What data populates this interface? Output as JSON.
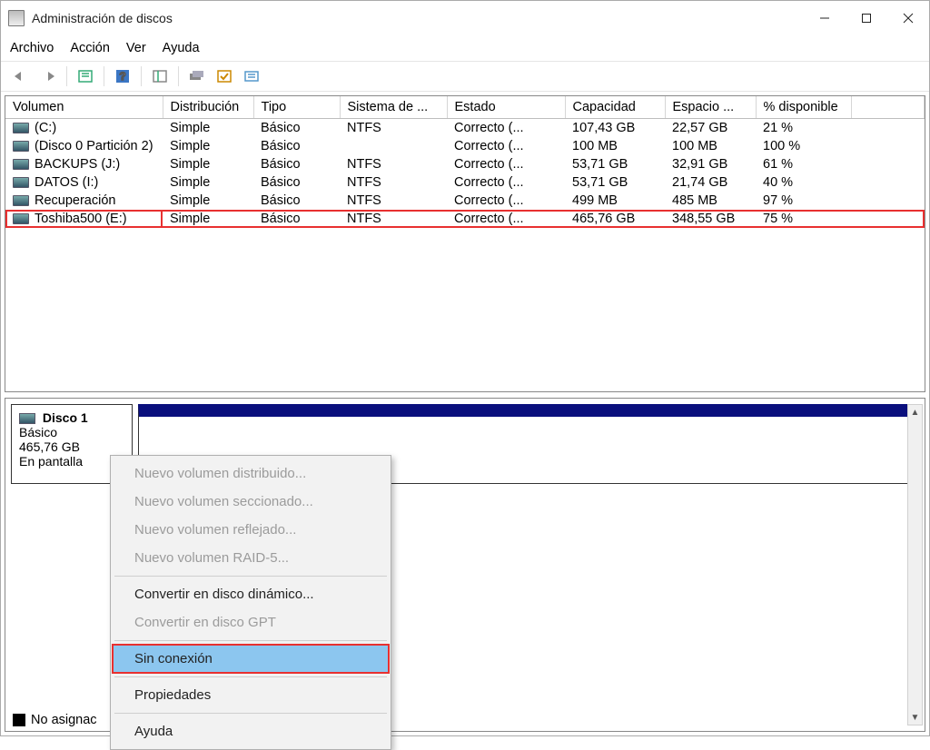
{
  "window": {
    "title": "Administración de discos"
  },
  "menu": {
    "file": "Archivo",
    "action": "Acción",
    "view": "Ver",
    "help": "Ayuda"
  },
  "columns": {
    "volume": "Volumen",
    "layout": "Distribución",
    "type": "Tipo",
    "filesystem": "Sistema de ...",
    "status": "Estado",
    "capacity": "Capacidad",
    "free": "Espacio ...",
    "percent": "% disponible"
  },
  "volumes": [
    {
      "name": "(C:)",
      "layout": "Simple",
      "type": "Básico",
      "fs": "NTFS",
      "status": "Correcto (...",
      "cap": "107,43 GB",
      "free": "22,57 GB",
      "pct": "21 %"
    },
    {
      "name": "(Disco 0 Partición 2)",
      "layout": "Simple",
      "type": "Básico",
      "fs": "",
      "status": "Correcto (...",
      "cap": "100 MB",
      "free": "100 MB",
      "pct": "100 %"
    },
    {
      "name": "BACKUPS (J:)",
      "layout": "Simple",
      "type": "Básico",
      "fs": "NTFS",
      "status": "Correcto (...",
      "cap": "53,71 GB",
      "free": "32,91 GB",
      "pct": "61 %"
    },
    {
      "name": "DATOS (I:)",
      "layout": "Simple",
      "type": "Básico",
      "fs": "NTFS",
      "status": "Correcto (...",
      "cap": "53,71 GB",
      "free": "21,74 GB",
      "pct": "40 %"
    },
    {
      "name": "Recuperación",
      "layout": "Simple",
      "type": "Básico",
      "fs": "NTFS",
      "status": "Correcto (...",
      "cap": "499 MB",
      "free": "485 MB",
      "pct": "97 %"
    },
    {
      "name": "Toshiba500 (E:)",
      "layout": "Simple",
      "type": "Básico",
      "fs": "NTFS",
      "status": "Correcto (...",
      "cap": "465,76 GB",
      "free": "348,55 GB",
      "pct": "75 %"
    }
  ],
  "disk_panel": {
    "disk_name": "Disco 1",
    "disk_type": "Básico",
    "disk_size": "465,76 GB",
    "disk_status": "En pantalla"
  },
  "legend": {
    "unallocated": "No asignac"
  },
  "context_menu": {
    "new_spanned": "Nuevo volumen distribuido...",
    "new_striped": "Nuevo volumen seccionado...",
    "new_mirrored": "Nuevo volumen reflejado...",
    "new_raid5": "Nuevo volumen RAID-5...",
    "convert_dynamic": "Convertir en disco dinámico...",
    "convert_gpt": "Convertir en disco GPT",
    "offline": "Sin conexión",
    "properties": "Propiedades",
    "help": "Ayuda"
  }
}
